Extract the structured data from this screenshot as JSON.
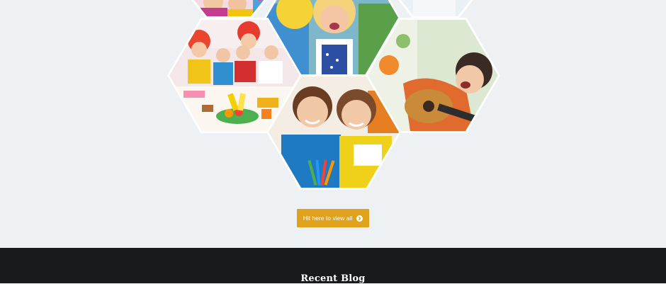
{
  "gallery": {
    "photos": [
      {
        "name": "gallery-photo-clown-kids-top"
      },
      {
        "name": "gallery-photo-girl-yellow-hair"
      },
      {
        "name": "gallery-photo-top-right"
      },
      {
        "name": "gallery-photo-party-table"
      },
      {
        "name": "gallery-photo-boy-guitar"
      },
      {
        "name": "gallery-photo-girls-drawing"
      }
    ]
  },
  "cta": {
    "label": "Hit here to view all",
    "icon": "chevron-circle-right-icon"
  },
  "recent_blog": {
    "title": "Recent Blog"
  },
  "colors": {
    "page_background": "#eef1f3",
    "accent": "#e0a21a",
    "footer_background": "#181a1b",
    "hex_border": "#ffffff"
  }
}
